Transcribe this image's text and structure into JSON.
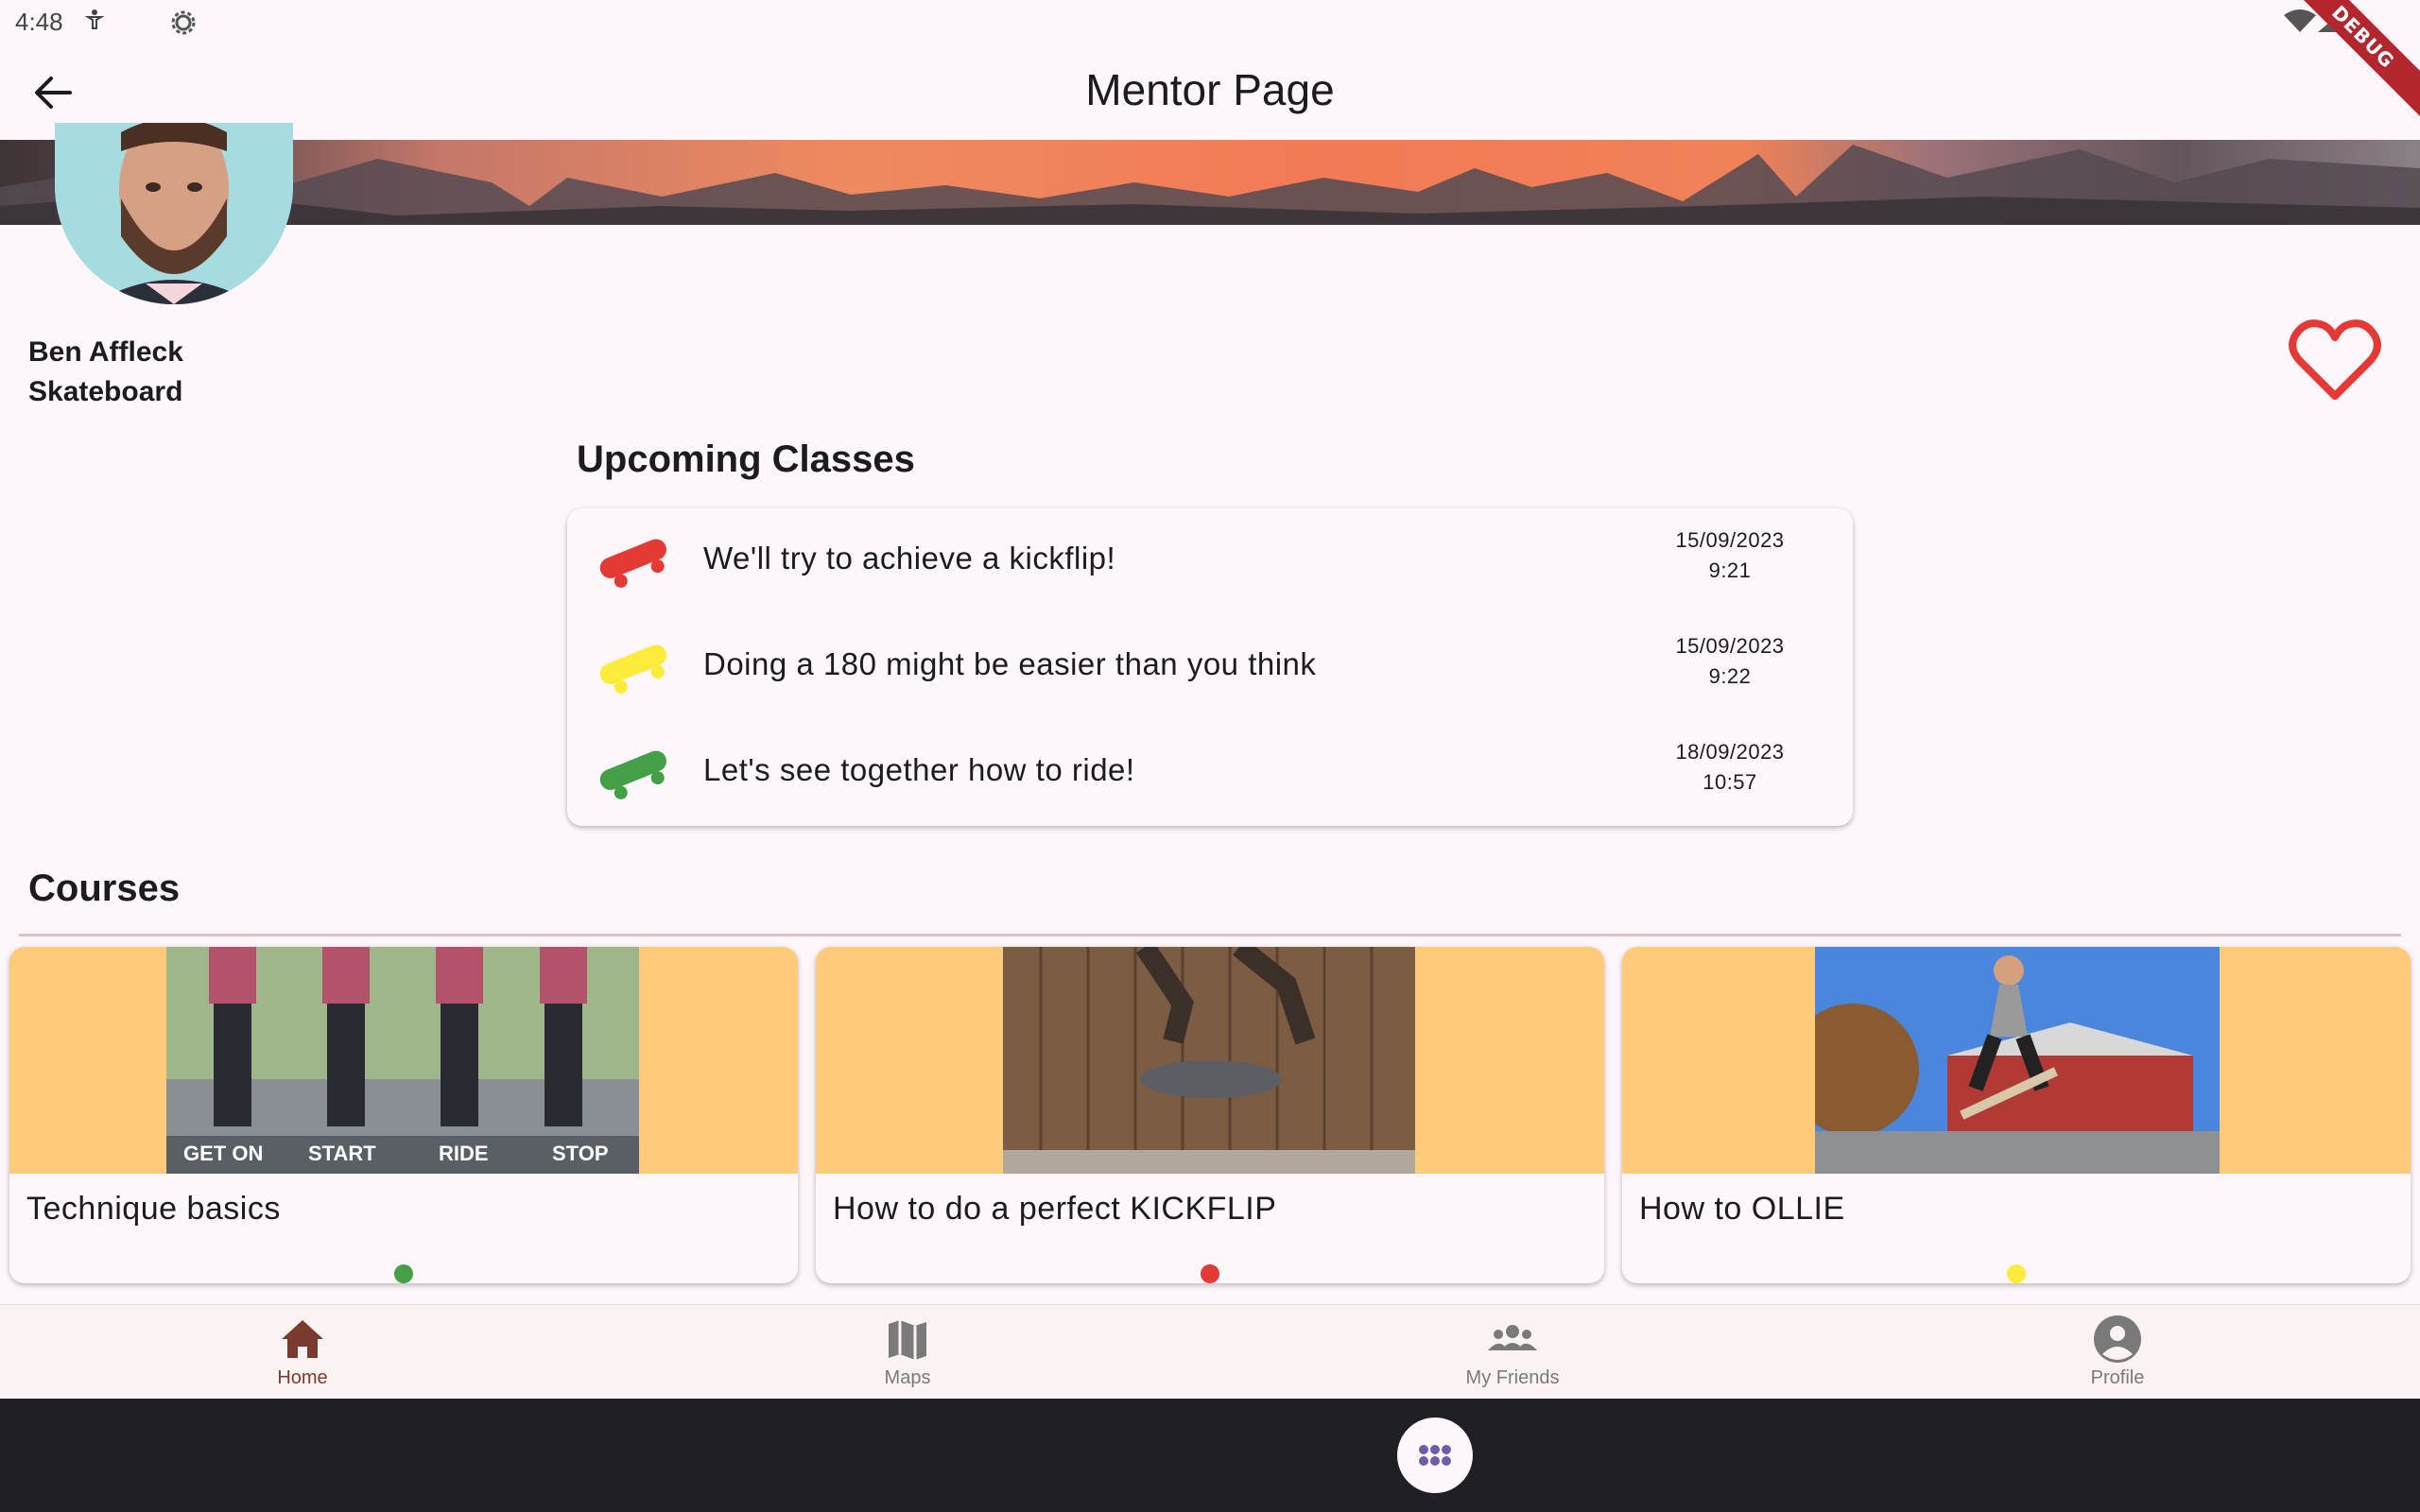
{
  "status_bar": {
    "time": "4:48",
    "debug_label": "DEBUG"
  },
  "app_bar": {
    "title": "Mentor Page"
  },
  "mentor": {
    "name": "Ben Affleck",
    "sport": "Skateboard"
  },
  "upcoming": {
    "heading": "Upcoming Classes",
    "items": [
      {
        "title": "We'll try to achieve a kickflip!",
        "date": "15/09/2023",
        "time": "9:21",
        "color": "#e53935"
      },
      {
        "title": "Doing a 180 might be easier than you think",
        "date": "15/09/2023",
        "time": "9:22",
        "color": "#fdea3b"
      },
      {
        "title": "Let's see together how to ride!",
        "date": "18/09/2023",
        "time": "10:57",
        "color": "#43a047"
      }
    ]
  },
  "courses": {
    "heading": "Courses",
    "items": [
      {
        "title": "Technique basics",
        "status_color": "#43a047",
        "image_captions": [
          "GET ON",
          "START",
          "RIDE",
          "STOP"
        ]
      },
      {
        "title": "How to do a perfect KICKFLIP",
        "status_color": "#e53935"
      },
      {
        "title": "How to OLLIE",
        "status_color": "#fdea3b"
      }
    ]
  },
  "bottom_nav": {
    "items": [
      {
        "label": "Home",
        "icon": "home-icon",
        "active": true
      },
      {
        "label": "Maps",
        "icon": "map-icon",
        "active": false
      },
      {
        "label": "My Friends",
        "icon": "people-icon",
        "active": false
      },
      {
        "label": "Profile",
        "icon": "account-circle-icon",
        "active": false
      }
    ]
  },
  "theme": {
    "accent": "#7a3b2e",
    "background": "#fdf7fb",
    "heart": "#e53935",
    "course_bg": "#ffca7a"
  }
}
